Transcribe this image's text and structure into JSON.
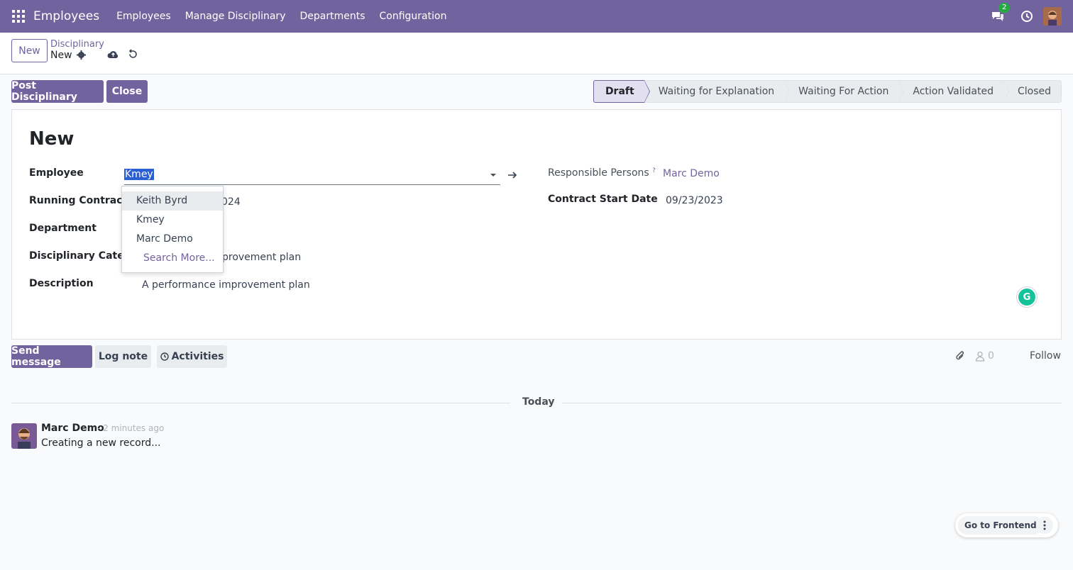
{
  "navbar": {
    "app_name": "Employees",
    "menus": [
      "Employees",
      "Manage Disciplinary",
      "Departments",
      "Configuration"
    ],
    "chat_count": "2"
  },
  "control_panel": {
    "new_label": "New",
    "breadcrumb": "Disciplinary",
    "record_name": "New"
  },
  "actions": {
    "post_label": "Post Disciplinary",
    "close_label": "Close"
  },
  "statusbar": {
    "stages": [
      "Draft",
      "Waiting for Explanation",
      "Waiting For Action",
      "Action Validated",
      "Closed"
    ],
    "active": "Draft"
  },
  "form": {
    "title": "New",
    "employee_label": "Employee",
    "employee_value": "Kmey",
    "running_contract_label": "Running Contract",
    "running_contract_value_tail": "024",
    "department_label": "Department",
    "category_label": "Disciplinary Categor",
    "category_value_tail": "provement plan",
    "description_label": "Description",
    "description_value": "A performance improvement plan",
    "responsible_label": "Responsible Persons",
    "responsible_help": "?",
    "responsible_value": "Marc Demo",
    "contract_start_label": "Contract Start Date",
    "contract_start_value": "09/23/2023"
  },
  "dropdown": {
    "items": [
      "Keith Byrd",
      "Kmey",
      "Marc Demo"
    ],
    "search_more": "Search More..."
  },
  "chatter": {
    "send_label": "Send message",
    "log_label": "Log note",
    "activities_label": "Activities",
    "followers_count": "0",
    "follow_label": "Follow",
    "today_label": "Today",
    "message": {
      "author": "Marc Demo",
      "time": "- 2 minutes ago",
      "body": "Creating a new record..."
    }
  },
  "frontend": {
    "label": "Go to Frontend"
  },
  "colors": {
    "brand": "#71639e",
    "badge": "#28a745",
    "selection": "#2a5fd3"
  }
}
